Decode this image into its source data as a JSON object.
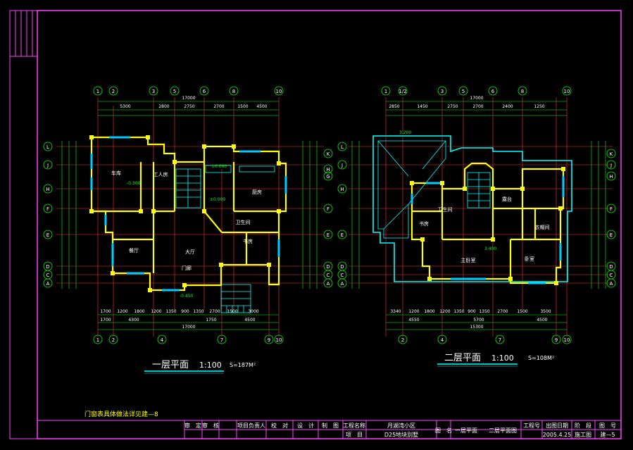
{
  "colors": {
    "background": "#000000",
    "frame": "#ff40ff",
    "wall": "#ffff00",
    "axis": "#ff3030",
    "dim": "#00ff00",
    "text": "#ffffff",
    "cyan": "#00ffff",
    "magenta": "#ff00ff",
    "window": "#00ccff"
  },
  "axes_top_plan1": [
    "1",
    "2",
    "3",
    "5",
    "6",
    "8",
    "10"
  ],
  "axes_bottom_plan1": [
    "1",
    "2",
    "4",
    "7",
    "9",
    "10"
  ],
  "axes_left_plan1": [
    "L",
    "J",
    "H",
    "F",
    "E",
    "D",
    "C",
    "A"
  ],
  "axes_right_plan1": [
    "K",
    "H",
    "G",
    "F",
    "E",
    "D",
    "C",
    "A"
  ],
  "axes_top_plan2": [
    "1",
    "1/2",
    "3",
    "5",
    "6",
    "8",
    "10"
  ],
  "axes_bottom_plan2": [
    "2",
    "4",
    "7",
    "9",
    "10"
  ],
  "axes_left_plan2": [
    "L",
    "J",
    "H",
    "E",
    "D",
    "C",
    "A"
  ],
  "axes_right_plan2": [
    "K",
    "J",
    "H",
    "F",
    "E",
    "D",
    "C",
    "A"
  ],
  "dims_plan1_top_total": "17000",
  "dims_plan1_top": [
    "5300",
    "2800",
    "2750",
    "2700",
    "1500",
    "4500"
  ],
  "dims_plan1_bottom": [
    "1700",
    "1200",
    "1800",
    "1200",
    "1350",
    "900",
    "1350",
    "2700",
    "1500",
    "3000"
  ],
  "dims_plan1_bottom_mid": [
    "1700",
    "4300",
    "1750",
    "4500"
  ],
  "dims_plan1_bottom_total": "17000",
  "dims_plan2_top_total": "17000",
  "dims_plan2_top": [
    "2850",
    "1450",
    "2750",
    "2700",
    "2400",
    "1250"
  ],
  "dims_plan2_bottom": [
    "3340",
    "1200",
    "1800",
    "1200",
    "1350",
    "900",
    "1350",
    "2700",
    "1500",
    "3500"
  ],
  "dims_plan2_bottom_mid": [
    "4550",
    "5700",
    "4500"
  ],
  "dims_plan2_bottom_total": "15300",
  "rooms_plan1": {
    "garage": "车库",
    "hall": "大厅",
    "kitchen": "厨房",
    "dining": "餐厅",
    "bath": "卫生间",
    "study": "书房",
    "staff": "工人房",
    "porch": "门廊"
  },
  "rooms_plan2": {
    "bedroom": "卧室",
    "master_bedroom": "主卧室",
    "bath": "卫生间",
    "study": "书房",
    "terrace": "露台",
    "closet": "衣帽间"
  },
  "levels": {
    "l1": "±0.000",
    "l2": "-0.300",
    "l3": "-0.450",
    "l4": "3.400",
    "l5": "3.200"
  },
  "title_plan1": "一层平面",
  "scale_plan1": "1:100",
  "area_plan1": "S=187M²",
  "title_plan2": "二层平面",
  "scale_plan2": "1:100",
  "area_plan2": "S=108M²",
  "note_bottom_left": "门窗表具体做法详见建—8",
  "titleblock": {
    "approve": "审　定",
    "check": "审　核",
    "project_lead": "项目负责人",
    "proof": "校　对",
    "design": "设　计",
    "draw": "制　图",
    "project_name_label": "工程名称",
    "project_label": "项　目",
    "project_name": "月湖湾小区",
    "project_sub": "D25地块别墅",
    "drawing_label": "图　名",
    "drawing_name": "一层平面　　二层平面图",
    "job_no_label": "工程号",
    "date_label": "出图日期",
    "date": "2005.4.25",
    "stage_label": "阶　段",
    "stage": "施工图",
    "sheet_no_label": "图　号",
    "sheet_no": "建—5"
  }
}
